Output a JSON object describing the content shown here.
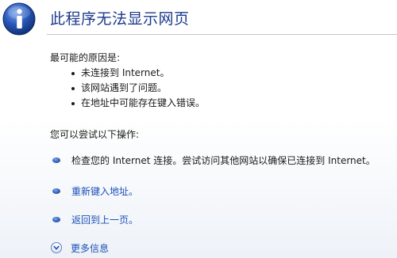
{
  "header": {
    "title": "此程序无法显示网页",
    "icon": "info-icon"
  },
  "causes": {
    "heading": "最可能的原因是:",
    "items": [
      "未连接到 Internet。",
      "该网站遇到了问题。",
      "在地址中可能存在键入错误。"
    ]
  },
  "actions": {
    "heading": "您可以尝试以下操作:",
    "check_connection": "检查您的 Internet 连接。尝试访问其他网站以确保已连接到 Internet。",
    "retype_address": "重新键入地址。",
    "go_back": "返回到上一页。",
    "more_info": "更多信息"
  },
  "colors": {
    "title": "#1b3a8a",
    "link": "#1c50b8",
    "bullet": "#2f5fb8"
  }
}
